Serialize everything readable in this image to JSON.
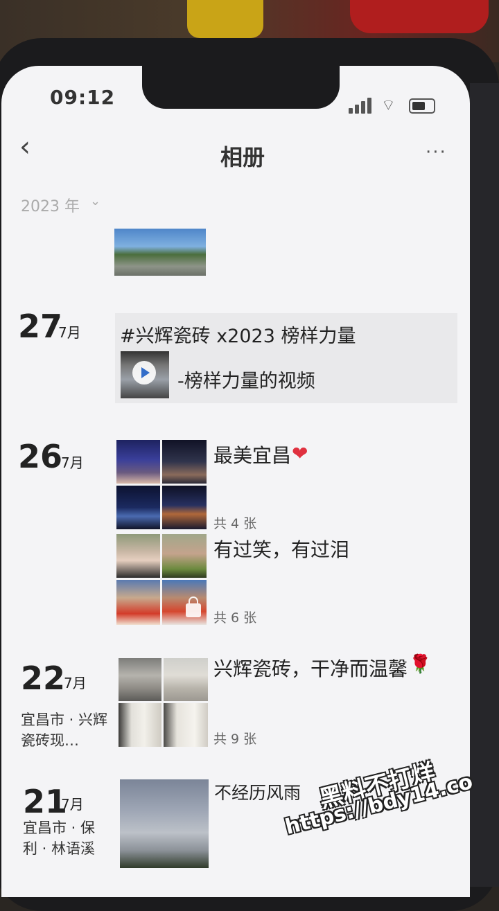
{
  "status_bar": {
    "time": "09:12"
  },
  "nav": {
    "back_icon": "‹",
    "title": "相册",
    "more_icon": "···"
  },
  "year_filter": {
    "label": "2023 年",
    "chevron": "⌄"
  },
  "entries": [
    {
      "day": "27",
      "month": "7月",
      "share_title": "#兴辉瓷砖 x2023 榜样力量",
      "share_desc": "-榜样力量的视频"
    },
    {
      "day": "26",
      "month": "7月",
      "albums": [
        {
          "caption": "最美宜昌",
          "count": "共 4 张"
        },
        {
          "caption": "有过笑，有过泪",
          "count": "共 6 张"
        }
      ]
    },
    {
      "day": "22",
      "month": "7月",
      "location": "宜昌市 · 兴辉瓷砖现…",
      "caption": "兴辉瓷砖，干净而温馨",
      "count": "共 9 张"
    },
    {
      "day": "21",
      "month": "7月",
      "location": "宜昌市 · 保利 · 林语溪",
      "caption": "不经历风雨"
    }
  ],
  "watermark": {
    "line1": "黑料不打烊",
    "line2": "https://bdy14.co"
  },
  "colors": {
    "heart": "#e0313f",
    "screen_bg": "#f4f4f6"
  }
}
